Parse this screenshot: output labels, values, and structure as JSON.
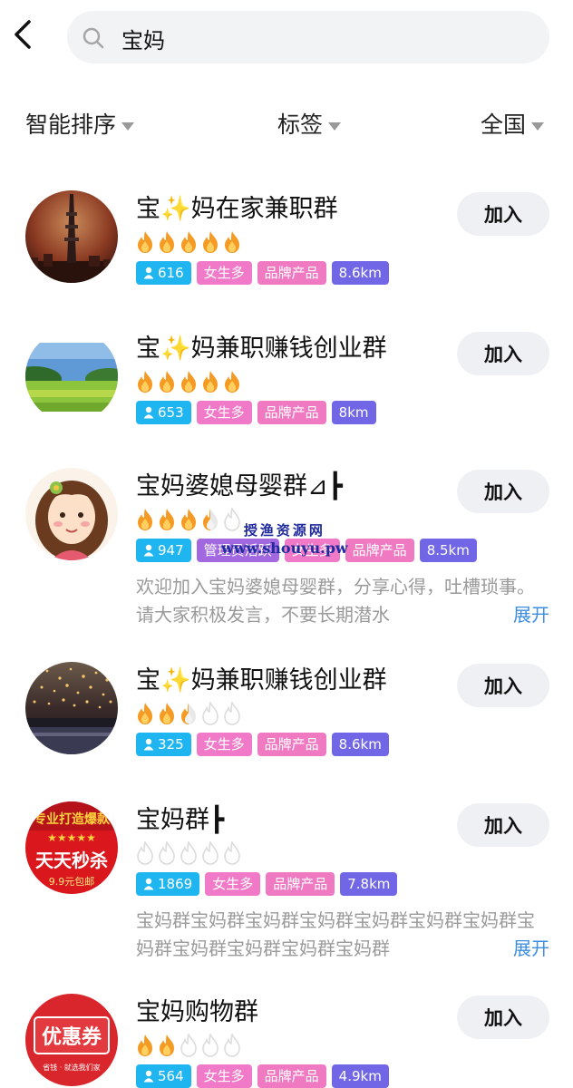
{
  "search": {
    "query": "宝妈"
  },
  "filters": [
    "智能排序",
    "标签",
    "全国"
  ],
  "join_label": "加入",
  "more_label": "展开",
  "watermark": {
    "line1": "授渔资源网",
    "line2": "www.shouyu.pw"
  },
  "groups": [
    {
      "name": "宝✨妈在家兼职群",
      "heat": 5,
      "members": "616",
      "tags": [
        "女生多",
        "品牌产品"
      ],
      "distance": "8.6km",
      "desc": ""
    },
    {
      "name": "宝✨妈兼职赚钱创业群",
      "heat": 5,
      "members": "653",
      "tags": [
        "女生多",
        "品牌产品"
      ],
      "distance": "8km",
      "desc": ""
    },
    {
      "name": "宝妈婆媳母婴群⊿┣",
      "heat": 3.5,
      "members": "947",
      "tags": [
        "管理员活跃",
        "女生多",
        "品牌产品"
      ],
      "distance": "8.5km",
      "desc": "欢迎加入宝妈婆媳母婴群，分享心得，吐槽琐事。请大家积极发言，不要长期潜水"
    },
    {
      "name": "宝✨妈兼职赚钱创业群",
      "heat": 2.5,
      "members": "325",
      "tags": [
        "女生多",
        "品牌产品"
      ],
      "distance": "8.6km",
      "desc": ""
    },
    {
      "name": "宝妈群┣",
      "heat": 0,
      "members": "1869",
      "tags": [
        "女生多",
        "品牌产品"
      ],
      "distance": "7.8km",
      "desc": "宝妈群宝妈群宝妈群宝妈群宝妈群宝妈群宝妈群宝妈群宝妈群宝妈群宝妈群宝妈群"
    },
    {
      "name": "宝妈购物群",
      "heat": 2,
      "members": "564",
      "tags": [
        "女生多",
        "品牌产品"
      ],
      "distance": "4.9km",
      "desc": ""
    }
  ],
  "avatar_texts": {
    "a5": {
      "top": "专业打造爆款",
      "mid": "天天秒杀",
      "bottom": "9.9元包邮"
    },
    "a6": {
      "main": "优惠券",
      "bottom": "省钱 · 就选我们家"
    }
  }
}
